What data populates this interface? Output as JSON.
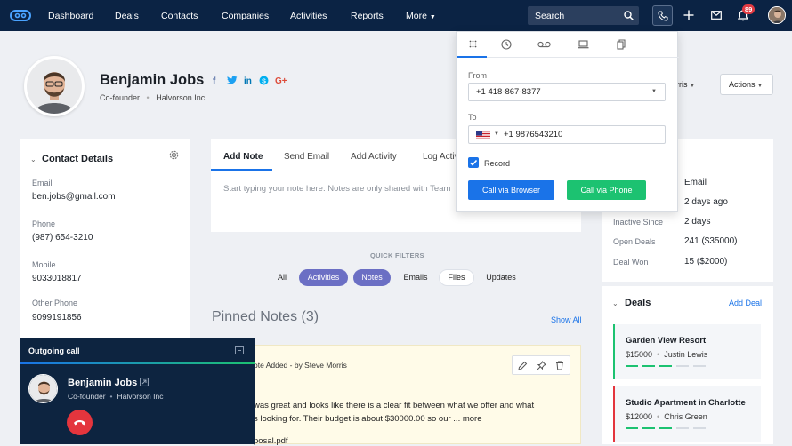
{
  "nav": {
    "items": [
      "Dashboard",
      "Deals",
      "Contacts",
      "Companies",
      "Activities",
      "Reports",
      "More"
    ],
    "search_placeholder": "Search",
    "notif_count": "89"
  },
  "profile": {
    "name": "Benjamin Jobs",
    "title": "Co-founder",
    "company": "Halvorson Inc",
    "owner_partial": "rris",
    "actions_label": "Actions"
  },
  "contact": {
    "heading": "Contact Details",
    "fields": [
      {
        "label": "Email",
        "value": "ben.jobs@gmail.com"
      },
      {
        "label": "Phone",
        "value": "(987) 654-3210"
      },
      {
        "label": "Mobile",
        "value": "9033018817"
      },
      {
        "label": "Other Phone",
        "value": "9099191856"
      }
    ]
  },
  "note_tabs": [
    "Add Note",
    "Send Email",
    "Add Activity",
    "Log Activ"
  ],
  "note_placeholder": "Start typing your note here. Notes are only shared with Team",
  "filters": {
    "heading": "QUICK FILTERS",
    "chips": [
      "All",
      "Activities",
      "Notes",
      "Emails",
      "Files",
      "Updates"
    ]
  },
  "pinned": {
    "heading": "Pinned Notes (3)",
    "show_all": "Show All",
    "note_meta": "ote Added - by Steve Morris",
    "note_line1": "was great and looks like there is a clear fit between what we offer and what",
    "note_line2": "s looking for. Their budget is about $30000.00 so our ...",
    "more": "more",
    "attachment": "posal.pdf"
  },
  "stats": {
    "rows": [
      {
        "label": "",
        "value": "Email"
      },
      {
        "label": "",
        "value": "2 days ago"
      },
      {
        "label": "Inactive Since",
        "value": "2 days"
      },
      {
        "label": "Open Deals",
        "value": "241 ($35000)"
      },
      {
        "label": "Deal Won",
        "value": "15 ($2000)"
      }
    ]
  },
  "deals": {
    "heading": "Deals",
    "add_label": "Add Deal",
    "items": [
      {
        "name": "Garden View Resort",
        "amount": "$15000",
        "owner": "Justin Lewis",
        "progress": 0.6
      },
      {
        "name": "Studio Apartment in Charlotte",
        "amount": "$12000",
        "owner": "Chris Green",
        "progress": 0.6
      }
    ]
  },
  "dialer": {
    "from_label": "From",
    "from_value": "+1 418-867-8377",
    "to_label": "To",
    "to_value": "+1 9876543210",
    "record_label": "Record",
    "browser_btn": "Call via Browser",
    "phone_btn": "Call via Phone"
  },
  "outgoing": {
    "heading": "Outgoing call",
    "name": "Benjamin Jobs",
    "title": "Co-founder",
    "company": "Halvorson Inc"
  },
  "colors": {
    "nav": "#0b2344",
    "accent": "#1a73e8",
    "call_green": "#1cc271",
    "hangup": "#e4353d",
    "chip": "#6b6fc4"
  }
}
